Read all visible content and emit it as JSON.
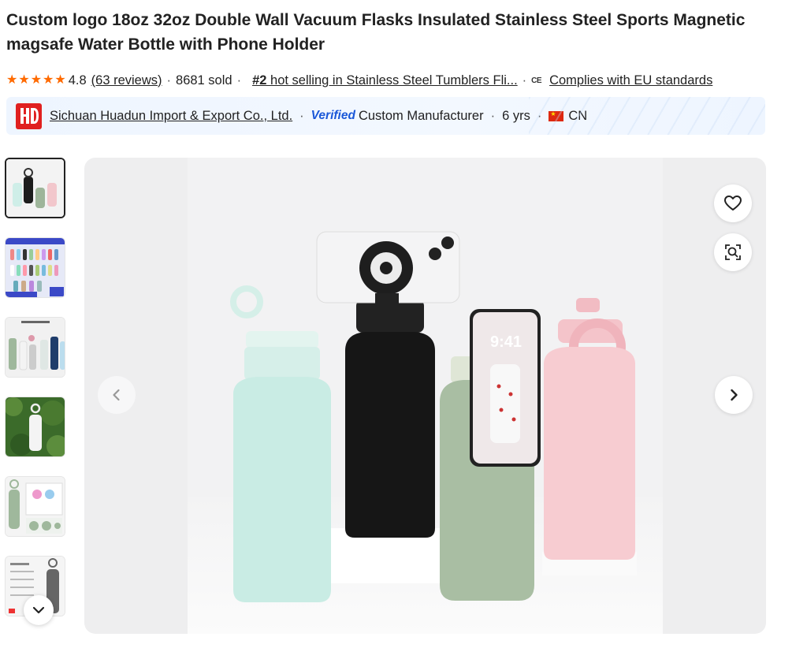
{
  "product": {
    "title": "Custom logo 18oz 32oz Double Wall Vacuum Flasks Insulated Stainless Steel Sports Magnetic magsafe Water Bottle with Phone Holder"
  },
  "rating": {
    "value": "4.8",
    "stars": 5,
    "reviews": "(63 reviews)",
    "sold": "8681 sold",
    "rank_number": "#2",
    "rank_text": " hot selling in Stainless Steel Tumblers Fli...",
    "ce_mark": "CE",
    "compliance": "Complies with EU standards"
  },
  "supplier": {
    "logo_text": "HD",
    "name": "Sichuan Huadun Import & Export Co., Ltd.",
    "verified_label": "Verified",
    "type": "Custom Manufacturer",
    "years": "6 yrs",
    "country": "CN"
  },
  "gallery": {
    "thumbnails": [
      {
        "name": "thumb-1",
        "active": true
      },
      {
        "name": "thumb-2",
        "active": false
      },
      {
        "name": "thumb-3",
        "active": false
      },
      {
        "name": "thumb-4",
        "active": false
      },
      {
        "name": "thumb-5",
        "active": false
      },
      {
        "name": "thumb-6",
        "active": false
      }
    ],
    "lockscreen_time": "9:41"
  },
  "icons": {
    "favorite": "heart-icon",
    "image_search": "image-search-icon",
    "prev": "chevron-left-icon",
    "next": "chevron-right-icon",
    "scroll_down": "chevron-down-icon"
  },
  "colors": {
    "star": "#ff6a00",
    "verified": "#1a57d8",
    "logo_red": "#e02020"
  }
}
